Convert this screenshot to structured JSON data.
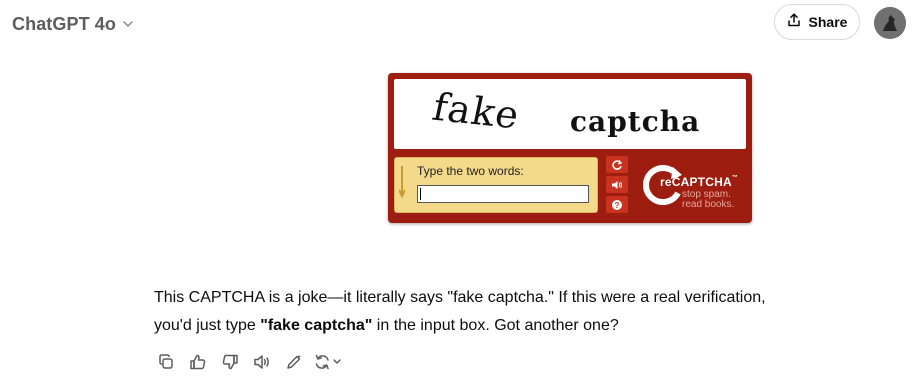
{
  "header": {
    "model_name": "ChatGPT 4o",
    "share_label": "Share"
  },
  "captcha": {
    "word1": "fake",
    "word2": "captcha",
    "prompt": "Type the two words:",
    "logo_prefix": "re",
    "logo_text": "CAPTCHA",
    "logo_tm": "™",
    "tagline_1": "stop spam.",
    "tagline_2": "read books."
  },
  "message": {
    "line1": "This CAPTCHA is a joke—it literally says \"fake captcha.\" If this were a real verification,",
    "line2_before": "you'd just type ",
    "line2_bold": "\"fake captcha\"",
    "line2_after": " in the input box. Got another one?"
  },
  "actions": [
    "copy-icon",
    "thumbs-up-icon",
    "thumbs-down-icon",
    "read-aloud-icon",
    "edit-icon",
    "regenerate-icon"
  ],
  "colors": {
    "captcha_red": "#9d1d10",
    "captcha_yellow": "#f5d98a",
    "text_primary": "#0d0d0d",
    "text_muted": "#5d5d5d"
  }
}
